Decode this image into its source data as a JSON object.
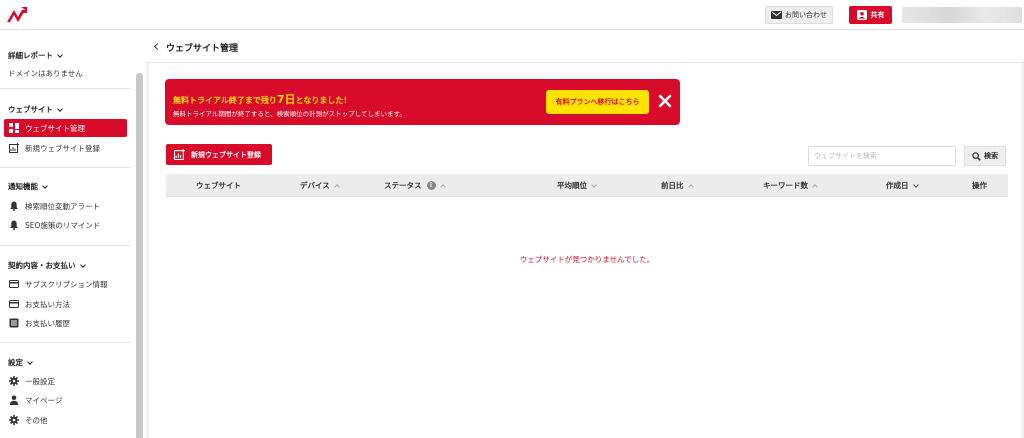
{
  "header": {
    "contact_label": "お問い合わせ",
    "share_label": "共有",
    "colors": {
      "brand": "#d80b2a"
    }
  },
  "sidebar": {
    "sections": [
      {
        "title": "詳細レポート",
        "empty_text": "ドメインはありません"
      },
      {
        "title": "ウェブサイト",
        "items": [
          {
            "label": "ウェブサイト管理",
            "icon": "dashboard-icon",
            "active": true
          },
          {
            "label": "新規ウェブサイト登録",
            "icon": "add-chart-icon"
          }
        ]
      },
      {
        "title": "通知機能",
        "items": [
          {
            "label": "検索順位変動アラート",
            "icon": "bell-icon"
          },
          {
            "label": "SEO施策のリマインド",
            "icon": "bell-icon"
          }
        ]
      },
      {
        "title": "契約内容・お支払い",
        "items": [
          {
            "label": "サブスクリプション情報",
            "icon": "card-icon"
          },
          {
            "label": "お支払い方法",
            "icon": "card-icon"
          },
          {
            "label": "お支払い履歴",
            "icon": "list-icon"
          }
        ]
      },
      {
        "title": "設定",
        "items": [
          {
            "label": "一般設定",
            "icon": "gear-icon"
          },
          {
            "label": "マイページ",
            "icon": "person-icon"
          },
          {
            "label": "その他",
            "icon": "gear-icon"
          }
        ]
      }
    ]
  },
  "page": {
    "title": "ウェブサイト管理"
  },
  "trial_banner": {
    "title_before": "無料トライアル終了まで残り",
    "days": "7日",
    "title_after": "となりました！",
    "subtitle": "無料トライアル期間が終了すると、検索順位の計測がストップしてしまいます。",
    "upgrade_label": "有料プランへ移行はこちら",
    "colors": {
      "text_highlight": "#ffe000",
      "button_bg": "#ffe400"
    }
  },
  "toolbar": {
    "add_label": "新規ウェブサイト登録",
    "search_placeholder": "ウェブサイトを検索",
    "search_value": "",
    "search_label": "検索"
  },
  "table": {
    "columns": [
      {
        "label": "ウェブサイト"
      },
      {
        "label": "デバイス"
      },
      {
        "label": "ステータス"
      },
      {
        "label": "平均順位"
      },
      {
        "label": "前日比"
      },
      {
        "label": "キーワード数"
      },
      {
        "label": "作成日"
      },
      {
        "label": "操作"
      }
    ],
    "rows": [],
    "empty_message": "ウェブサイトが見つかりませんでした。"
  }
}
